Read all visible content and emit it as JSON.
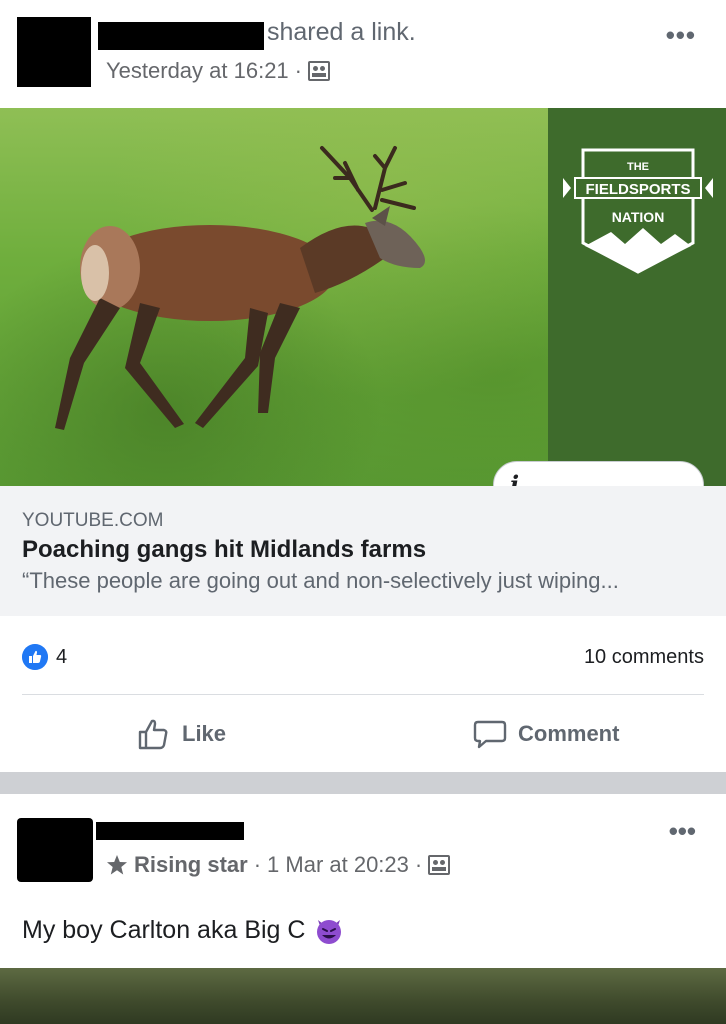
{
  "post1": {
    "shared_text": "shared a link.",
    "timestamp": "Yesterday at 16:21",
    "timestamp_separator": "·",
    "privacy_icon": "friends-icon",
    "more_icon": "more-options-icon",
    "link": {
      "domain": "YOUTUBE.COM",
      "title": "Poaching gangs hit Midlands farms",
      "description": "“These people are going out and non-selectively just wiping...",
      "brand_logo_text": [
        "THE",
        "FIELDSPORTS",
        "NATION"
      ],
      "info_icon": "i"
    },
    "reactions": {
      "like_count": "4",
      "comments": "10 comments"
    },
    "actions": {
      "like_label": "Like",
      "comment_label": "Comment"
    }
  },
  "post2": {
    "badge_label": "Rising star",
    "timestamp": "1 Mar at 20:23",
    "separator": "·",
    "post_text": "My boy Carlton aka Big C",
    "emoji": "smiling-devil-emoji"
  },
  "colors": {
    "facebook_blue": "#2078f4",
    "brand_green": "#3e6b2c",
    "secondary_text": "#606770",
    "link_meta_bg": "#f2f3f5",
    "separator_band": "#ced0d4"
  }
}
